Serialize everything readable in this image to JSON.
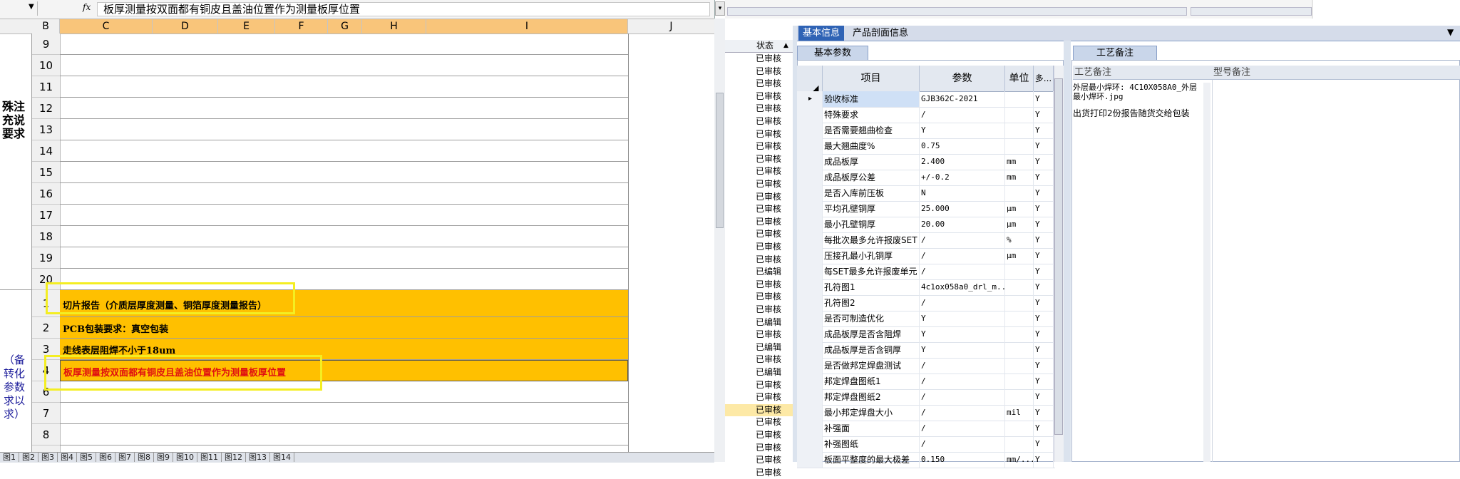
{
  "formula_bar": {
    "fx": "fx",
    "formula_text": "板厚测量按双面都有铜皮且盖油位置作为测量板厚位置"
  },
  "columns": [
    "B",
    "C",
    "D",
    "E",
    "F",
    "G",
    "H",
    "I",
    "J"
  ],
  "rows_top": [
    "9",
    "10",
    "11",
    "12",
    "13",
    "14",
    "15",
    "16",
    "17",
    "18",
    "19",
    "20"
  ],
  "left_label_1": "殊注\n充说\n要求",
  "rows_bottom": [
    {
      "num": "1",
      "text": "切片报告（介质层厚度测量、铜箔厚度测量报告）",
      "style": "normal"
    },
    {
      "num": "2",
      "text": "PCB包装要求：真空包装",
      "style": "normal"
    },
    {
      "num": "3",
      "text": "走线表层阻焊不小于18um",
      "style": "normal"
    },
    {
      "num": "4",
      "text": "板厚测量按双面都有铜皮且盖油位置作为测量板厚位置",
      "style": "red"
    },
    {
      "num": "6",
      "text": "",
      "style": "plain"
    },
    {
      "num": "7",
      "text": "",
      "style": "plain"
    },
    {
      "num": "8",
      "text": "",
      "style": "plain"
    }
  ],
  "left_label_2": "（备\n转化\n参数\n求以\n求）",
  "sheet_tabs": [
    "图1",
    "图2",
    "图3",
    "图4",
    "图5",
    "图6",
    "图7",
    "图8",
    "图9",
    "图10",
    "图11",
    "图12",
    "图13",
    "图14"
  ],
  "status_list": {
    "header": "状态",
    "items": [
      "已审核",
      "已审核",
      "已审核",
      "已审核",
      "已审核",
      "已审核",
      "已审核",
      "已审核",
      "已审核",
      "已审核",
      "已审核",
      "已审核",
      "已审核",
      "已审核",
      "已审核",
      "已审核",
      "已审核",
      "已编辑",
      "已审核",
      "已审核",
      "已审核",
      "已编辑",
      "已审核",
      "已编辑",
      "已审核",
      "已编辑",
      "已审核",
      "已审核",
      "已审核",
      "已审核",
      "已审核",
      "已审核",
      "已审核",
      "已审核"
    ]
  },
  "right_panel": {
    "tabs": [
      "基本信息",
      "产品剖面信息"
    ],
    "subtab": "基本参数",
    "grid_headers": [
      "项目",
      "参数",
      "单位",
      "多..."
    ],
    "grid_rows": [
      {
        "item": "验收标准",
        "param": "GJB362C-2021",
        "unit": "",
        "flag": "Y"
      },
      {
        "item": "特殊要求",
        "param": "/",
        "unit": "",
        "flag": "Y"
      },
      {
        "item": "是否需要翘曲检查",
        "param": "Y",
        "unit": "",
        "flag": "Y"
      },
      {
        "item": "最大翘曲度%",
        "param": "0.75",
        "unit": "",
        "flag": "Y"
      },
      {
        "item": "成品板厚",
        "param": "2.400",
        "unit": "mm",
        "flag": "Y"
      },
      {
        "item": "成品板厚公差",
        "param": "+/-0.2",
        "unit": "mm",
        "flag": "Y"
      },
      {
        "item": "是否入库前压板",
        "param": "N",
        "unit": "",
        "flag": "Y"
      },
      {
        "item": "平均孔壁铜厚",
        "param": "25.000",
        "unit": "μm",
        "flag": "Y"
      },
      {
        "item": "最小孔壁铜厚",
        "param": "20.00",
        "unit": "μm",
        "flag": "Y"
      },
      {
        "item": "每批次最多允许报废SET",
        "param": "/",
        "unit": "%",
        "flag": "Y"
      },
      {
        "item": "压接孔最小孔铜厚",
        "param": "/",
        "unit": "μm",
        "flag": "Y"
      },
      {
        "item": "每SET最多允许报废单元",
        "param": "/",
        "unit": "",
        "flag": "Y"
      },
      {
        "item": "孔符图1",
        "param": "4c1ox058a0_drl_m...",
        "unit": "",
        "flag": "Y"
      },
      {
        "item": "孔符图2",
        "param": "/",
        "unit": "",
        "flag": "Y"
      },
      {
        "item": "是否可制造优化",
        "param": "Y",
        "unit": "",
        "flag": "Y"
      },
      {
        "item": "成品板厚是否含阻焊",
        "param": "Y",
        "unit": "",
        "flag": "Y"
      },
      {
        "item": "成品板厚是否含铜厚",
        "param": "Y",
        "unit": "",
        "flag": "Y"
      },
      {
        "item": "是否做邦定焊盘测试",
        "param": "/",
        "unit": "",
        "flag": "Y"
      },
      {
        "item": "邦定焊盘图纸1",
        "param": "/",
        "unit": "",
        "flag": "Y"
      },
      {
        "item": "邦定焊盘图纸2",
        "param": "/",
        "unit": "",
        "flag": "Y"
      },
      {
        "item": "最小邦定焊盘大小",
        "param": "/",
        "unit": "mil",
        "flag": "Y"
      },
      {
        "item": "补强面",
        "param": "/",
        "unit": "",
        "flag": "Y"
      },
      {
        "item": "补强图纸",
        "param": "/",
        "unit": "",
        "flag": "Y"
      },
      {
        "item": "板面平整度的最大极差",
        "param": "0.150",
        "unit": "mm/...",
        "flag": "Y"
      }
    ],
    "notes_tab": "工艺备注",
    "notes_headers": [
      "工艺备注",
      "型号备注"
    ],
    "note_1": "外层最小焊环: 4C10X058A0_外层最小焊环.jpg",
    "note_2": "出货打印2份报告随货交给包装"
  }
}
